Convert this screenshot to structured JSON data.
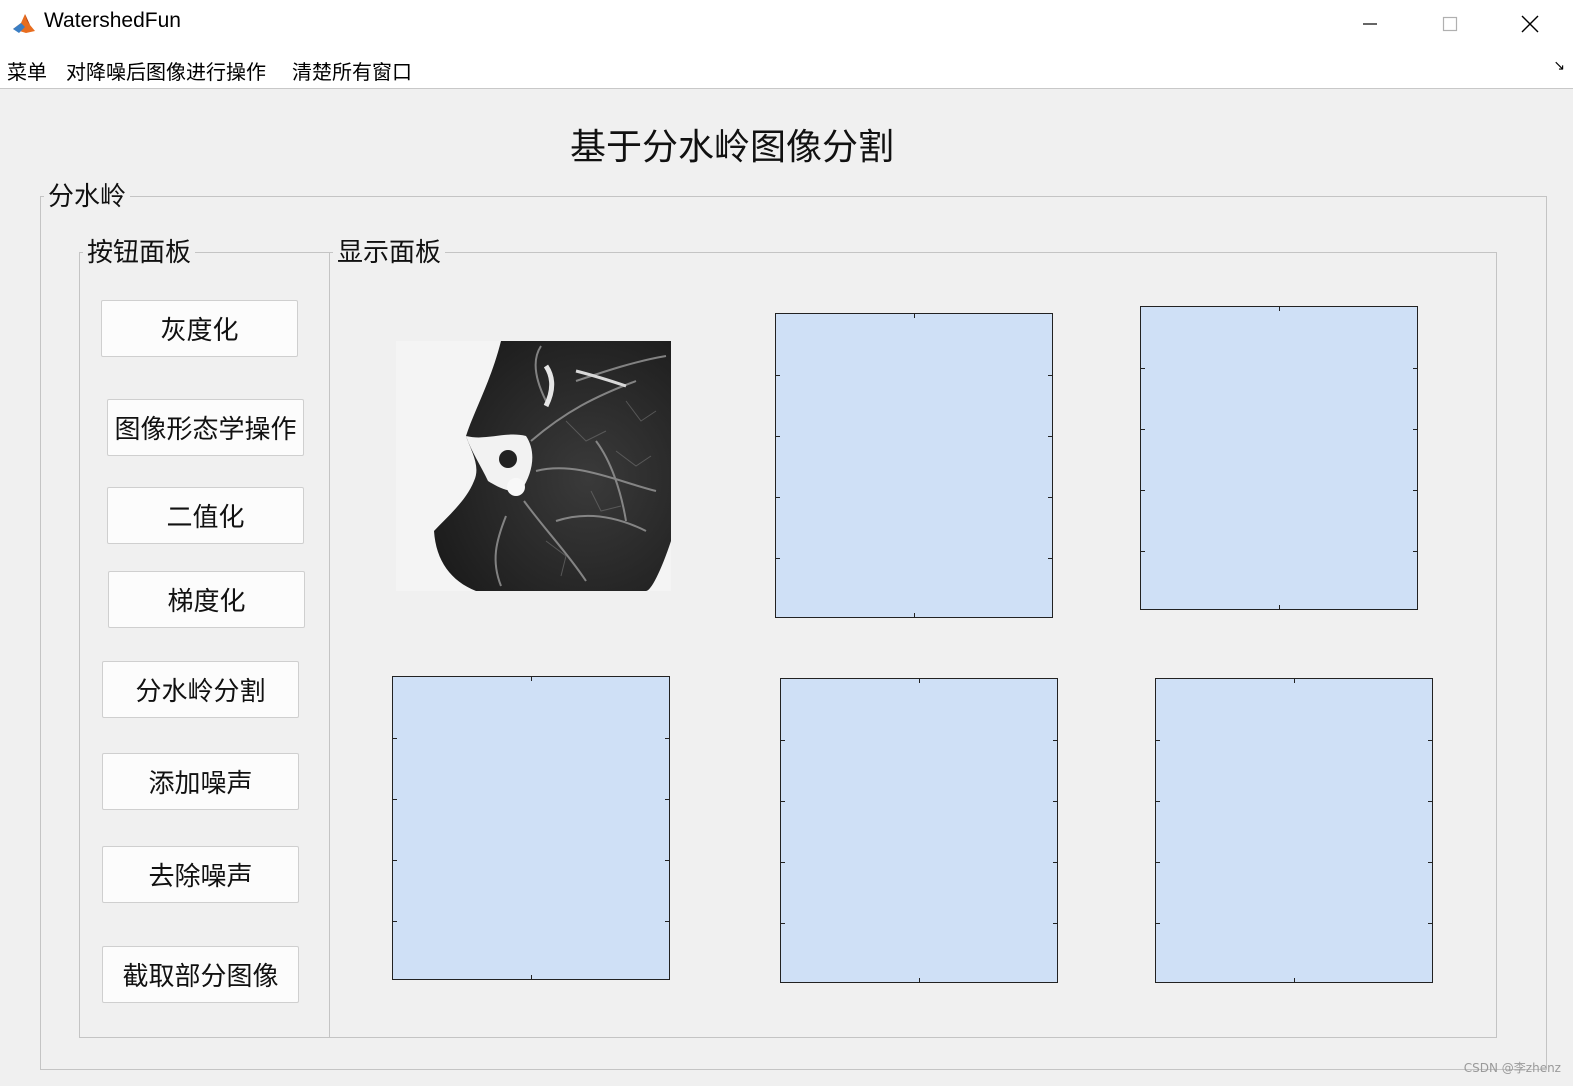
{
  "window": {
    "title": "WatershedFun",
    "icon": "matlab-icon"
  },
  "menu": [
    {
      "label": "菜单"
    },
    {
      "label": "对降噪后图像进行操作"
    },
    {
      "label": "清楚所有窗口"
    }
  ],
  "main_title": "基于分水岭图像分割",
  "outer_panel": {
    "label": "分水岭"
  },
  "button_panel": {
    "label": "按钮面板",
    "buttons": [
      {
        "label": "灰度化"
      },
      {
        "label": "图像形态学操作"
      },
      {
        "label": "二值化"
      },
      {
        "label": "梯度化"
      },
      {
        "label": "分水岭分割"
      },
      {
        "label": "添加噪声"
      },
      {
        "label": "去除噪声"
      },
      {
        "label": "截取部分图像"
      }
    ]
  },
  "display_panel": {
    "label": "显示面板",
    "image": {
      "name": "lung-ct-image"
    },
    "axes_color": "#cfe0f6"
  },
  "watermark": "CSDN @李zhenz"
}
